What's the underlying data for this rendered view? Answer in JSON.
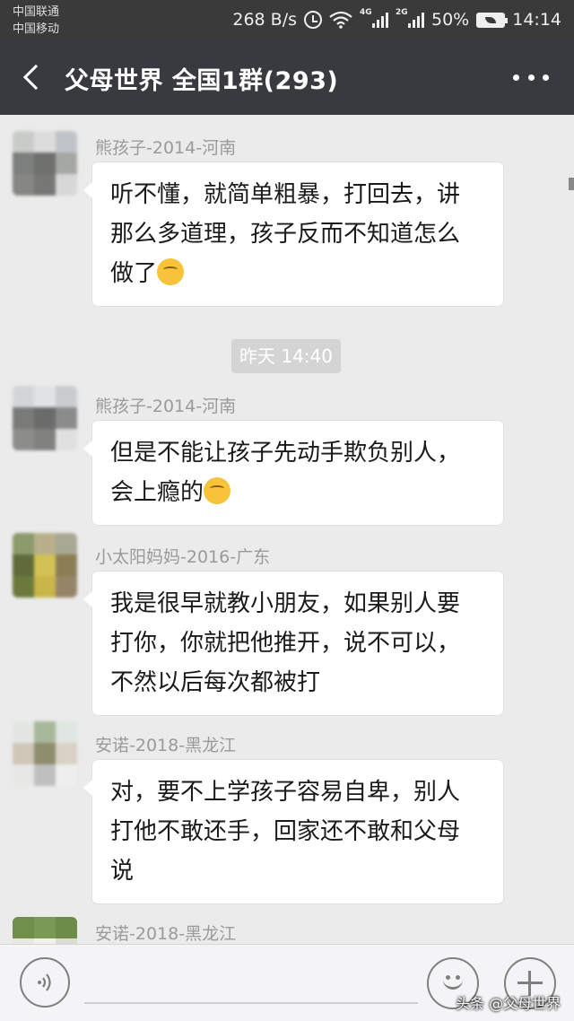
{
  "status_bar": {
    "carrier_1": "中国联通",
    "carrier_2": "中国移动",
    "net_speed": "268 B/s",
    "signal_1_tag": "4G",
    "signal_2_tag": "2G",
    "battery": "50%",
    "time": "14:14",
    "icons": [
      "alarm-icon",
      "wifi-icon",
      "signal-icon",
      "signal-icon",
      "battery-icon"
    ]
  },
  "header": {
    "title": "父母世界 全国1群(293)",
    "back_icon": "chevron-left-icon",
    "more_icon": "more-dots-icon"
  },
  "messages": [
    {
      "sender": "熊孩子-2014-河南",
      "lines": [
        "听不懂，就简单粗暴，打回去，讲",
        "那么多道理，孩子反而不知道怎么",
        "做了"
      ],
      "emoji": "smirk-emoji-icon"
    },
    {
      "sender": "熊孩子-2014-河南",
      "lines": [
        "但是不能让孩子先动手欺负别人，",
        "会上瘾的"
      ],
      "emoji": "facepalm-emoji-icon"
    },
    {
      "sender": "小太阳妈妈-2016-广东",
      "lines": [
        "我是很早就教小朋友，如果别人要",
        "打你，你就把他推开，说不可以，",
        "不然以后每次都被打"
      ]
    },
    {
      "sender": "安诺-2018-黑龙江",
      "lines": [
        "对，要不上学孩子容易自卑，别人",
        "打他不敢还手，回家还不敢和父母",
        "说"
      ]
    },
    {
      "sender": "安诺-2018-黑龙江"
    }
  ],
  "timestamp": "昨天 14:40",
  "input_bar": {
    "voice_icon": "voice-icon",
    "emoji_icon": "smile-icon",
    "plus_icon": "plus-icon",
    "text_value": ""
  },
  "watermark": "头条 @父母世界"
}
